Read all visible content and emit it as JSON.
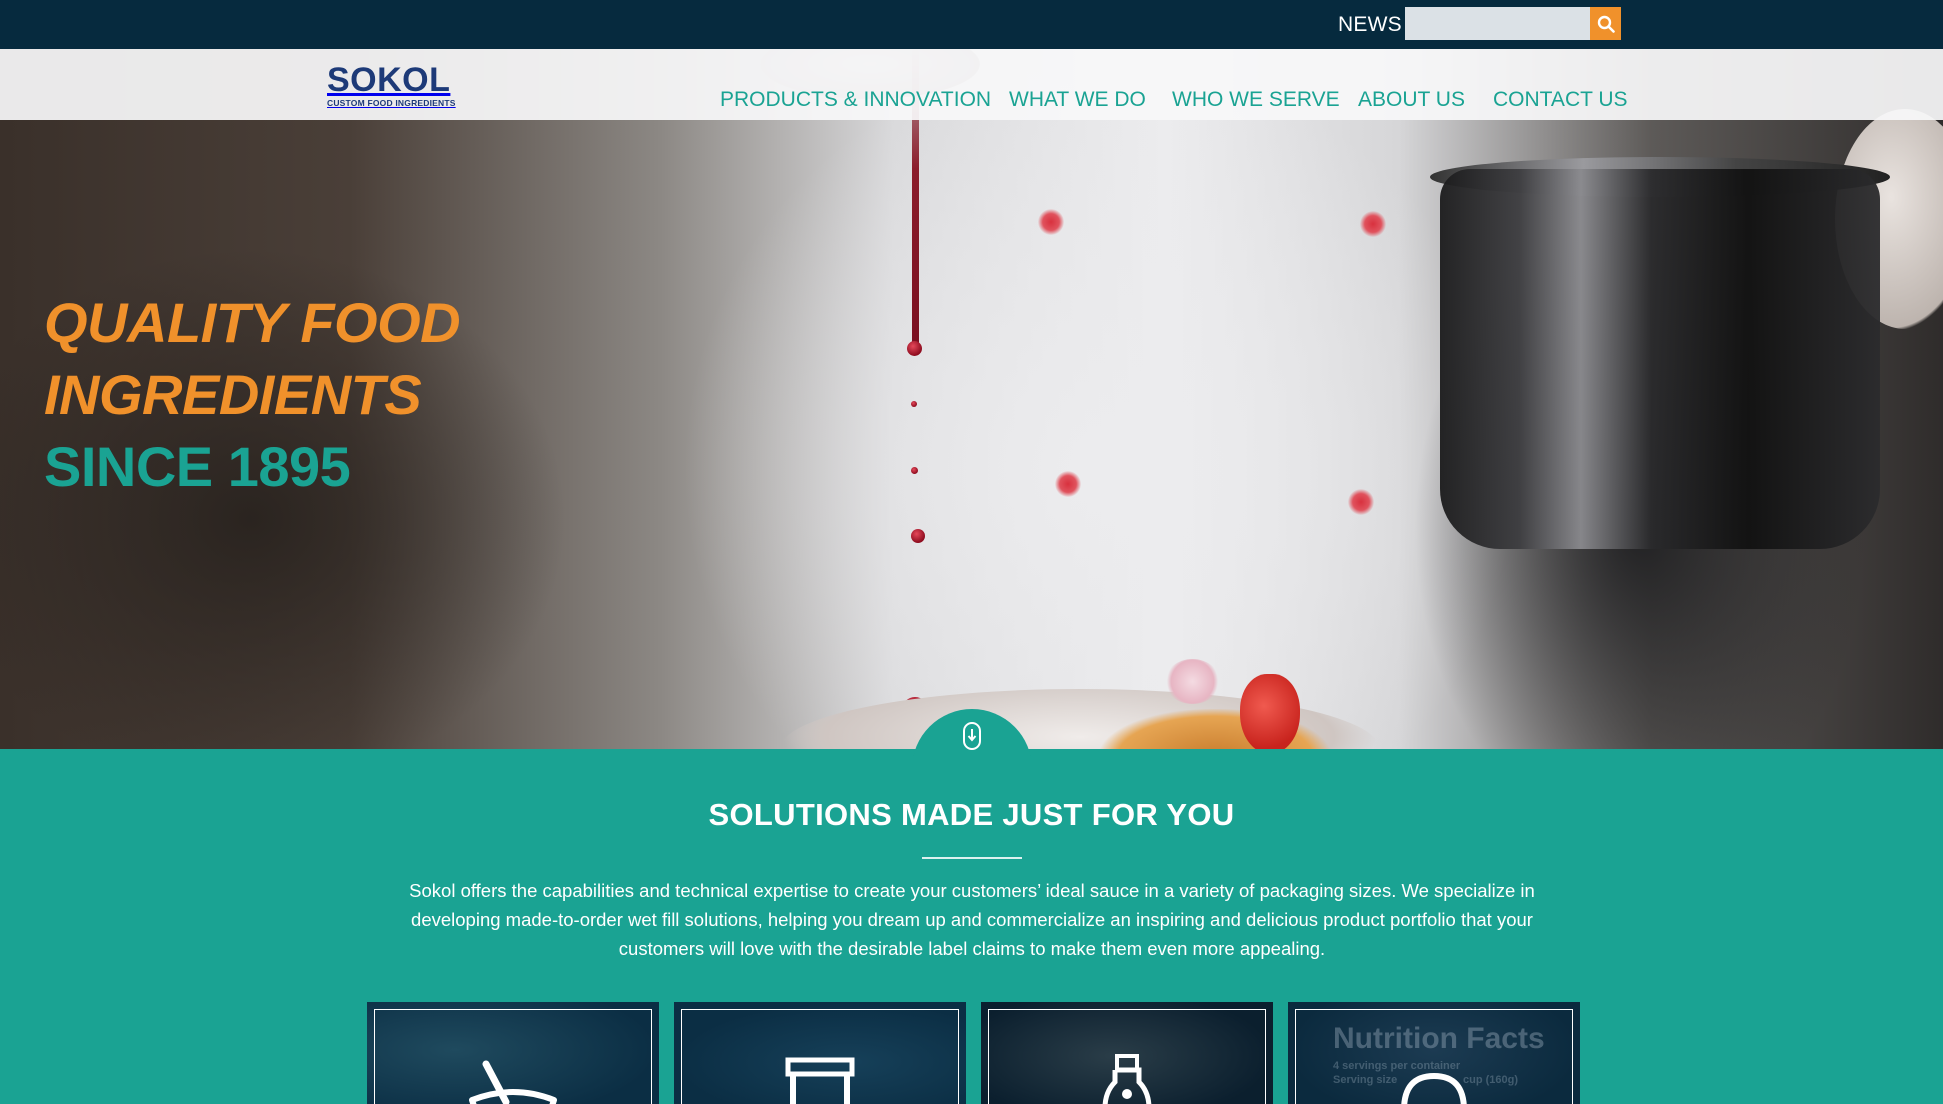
{
  "topbar": {
    "news_label": "NEWS",
    "search_placeholder": "",
    "search_icon": "magnifier-icon",
    "accent_color": "#f0912b",
    "background_color": "#062a3e"
  },
  "brand": {
    "logo_word": "SOKOL",
    "logo_tagline": "CUSTOM FOOD INGREDIENTS",
    "logo_color": "#1d3a78"
  },
  "nav": {
    "items": [
      {
        "label": "PRODUCTS & INNOVATION"
      },
      {
        "label": "WHAT WE DO"
      },
      {
        "label": "WHO WE SERVE"
      },
      {
        "label": "ABOUT US"
      },
      {
        "label": "CONTACT US"
      }
    ],
    "color": "#1aa393"
  },
  "hero": {
    "headline_line1": "QUALITY FOOD",
    "headline_line2": "INGREDIENTS",
    "headline_line3": "SINCE 1895",
    "scroll_icon": "mouse-scroll-down-icon"
  },
  "solutions": {
    "title": "SOLUTIONS MADE JUST FOR YOU",
    "description": "Sokol offers the capabilities and technical expertise to create your customers’ ideal sauce in a variety of packaging sizes. We specialize in developing made-to-order wet fill solutions, helping you dream up and commercialize an inspiring and delicious product portfolio that your customers will love with the desirable label claims to make them even more appealing.",
    "background_color": "#1aa393",
    "cards": [
      {
        "icon": "mortar-pestle-icon"
      },
      {
        "icon": "pouch-package-icon"
      },
      {
        "icon": "sauce-bottle-icon"
      },
      {
        "icon": "clean-label-icon",
        "bg_text_title": "Nutrition Facts",
        "bg_text_sub": "4 servings per container",
        "bg_text_sub2": "Serving size",
        "bg_text_sub3": "cup (160g)"
      }
    ]
  }
}
